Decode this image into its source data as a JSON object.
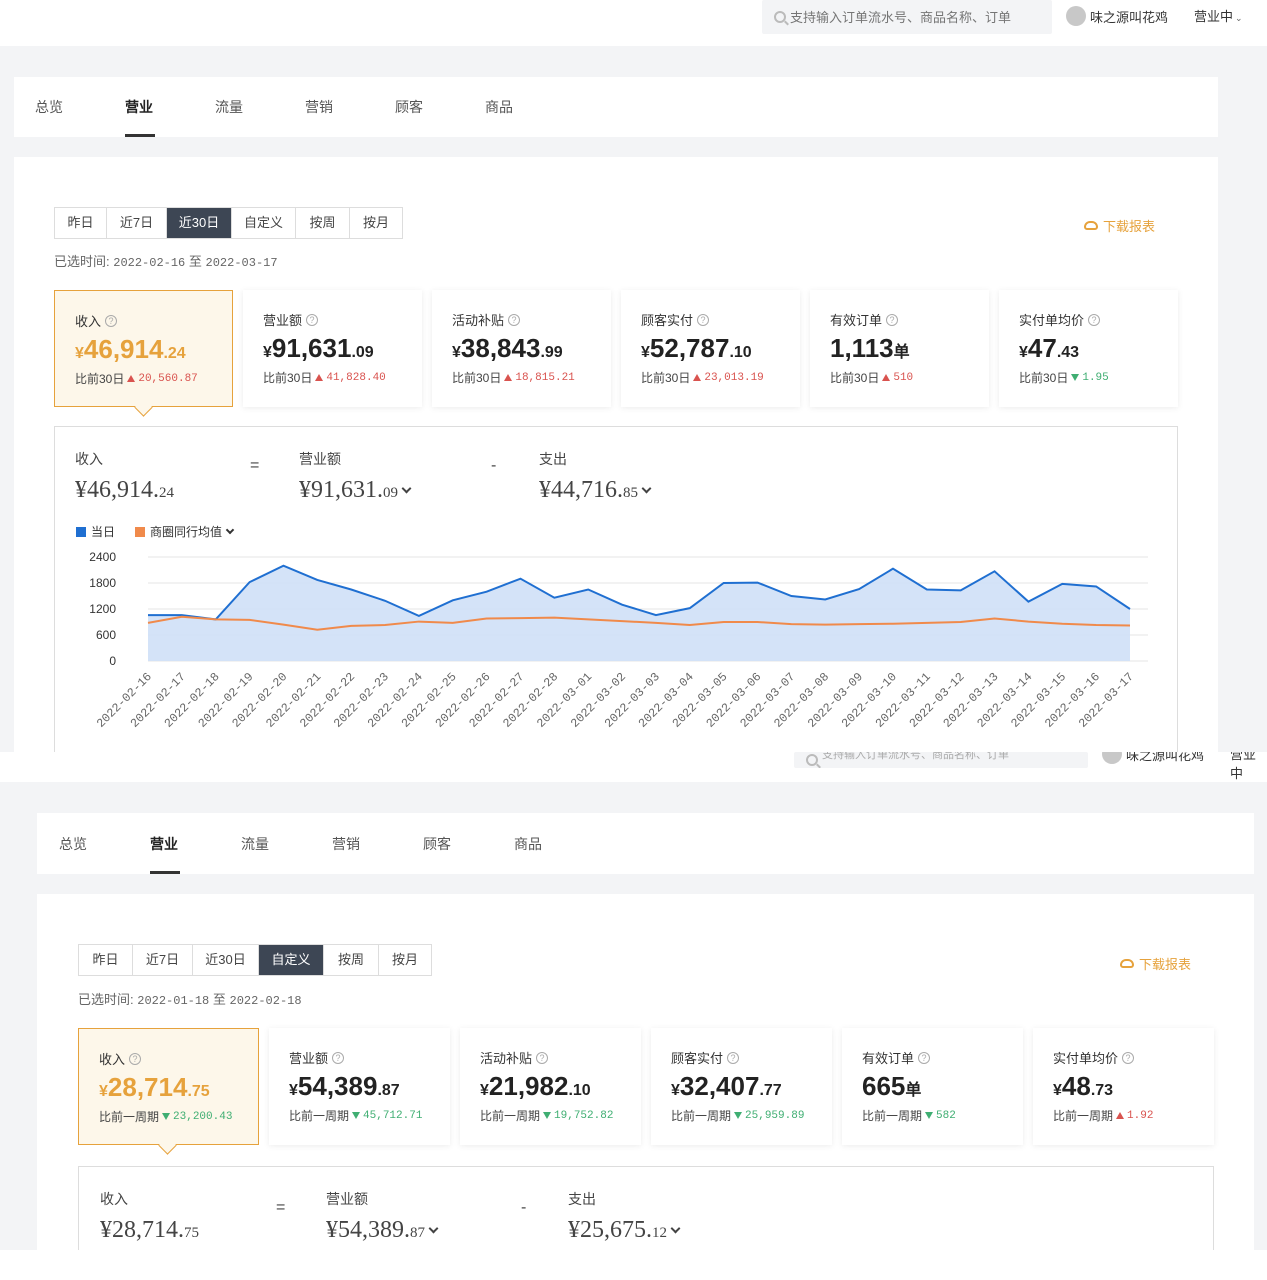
{
  "header": {
    "search_placeholder": "支持输入订单流水号、商品名称、订单",
    "user_name": "味之源叫花鸡",
    "status": "营业中"
  },
  "tabs": [
    "总览",
    "营业",
    "流量",
    "营销",
    "顾客",
    "商品"
  ],
  "active_tab": "营业",
  "periods": [
    "昨日",
    "近7日",
    "近30日",
    "自定义",
    "按周",
    "按月"
  ],
  "download_label": "下载报表",
  "screen1": {
    "active_period": "近30日",
    "range_label": "已选时间:",
    "range_start": "2022-02-16",
    "range_sep": "至",
    "range_end": "2022-03-17",
    "cards": [
      {
        "label": "收入",
        "cur": "¥",
        "int": "46,914",
        "dec": ".24",
        "cmp_label": "比前30日",
        "dir": "up",
        "delta": "20,560.87"
      },
      {
        "label": "营业额",
        "cur": "¥",
        "int": "91,631",
        "dec": ".09",
        "cmp_label": "比前30日",
        "dir": "up",
        "delta": "41,828.40"
      },
      {
        "label": "活动补贴",
        "cur": "¥",
        "int": "38,843",
        "dec": ".99",
        "cmp_label": "比前30日",
        "dir": "up",
        "delta": "18,815.21"
      },
      {
        "label": "顾客实付",
        "cur": "¥",
        "int": "52,787",
        "dec": ".10",
        "cmp_label": "比前30日",
        "dir": "up",
        "delta": "23,013.19"
      },
      {
        "label": "有效订单",
        "cur": "",
        "int": "1,113",
        "dec": "单",
        "cmp_label": "比前30日",
        "dir": "up",
        "delta": "510"
      },
      {
        "label": "实付单均价",
        "cur": "¥",
        "int": "47",
        "dec": ".43",
        "cmp_label": "比前30日",
        "dir": "down",
        "delta": "1.95"
      }
    ],
    "equation": {
      "a_label": "收入",
      "a_int": "¥46,914.",
      "a_dec": "24",
      "eq": "=",
      "b_label": "营业额",
      "b_int": "¥91,631.",
      "b_dec": "09",
      "minus": "-",
      "c_label": "支出",
      "c_int": "¥44,716.",
      "c_dec": "85"
    },
    "legend": {
      "current": "当日",
      "average": "商圈同行均值"
    }
  },
  "screen2": {
    "active_period": "自定义",
    "range_label": "已选时间:",
    "range_start": "2022-01-18",
    "range_sep": "至",
    "range_end": "2022-02-18",
    "cards": [
      {
        "label": "收入",
        "cur": "¥",
        "int": "28,714",
        "dec": ".75",
        "cmp_label": "比前一周期",
        "dir": "down",
        "delta": "23,200.43"
      },
      {
        "label": "营业额",
        "cur": "¥",
        "int": "54,389",
        "dec": ".87",
        "cmp_label": "比前一周期",
        "dir": "down",
        "delta": "45,712.71"
      },
      {
        "label": "活动补贴",
        "cur": "¥",
        "int": "21,982",
        "dec": ".10",
        "cmp_label": "比前一周期",
        "dir": "down",
        "delta": "19,752.82"
      },
      {
        "label": "顾客实付",
        "cur": "¥",
        "int": "32,407",
        "dec": ".77",
        "cmp_label": "比前一周期",
        "dir": "down",
        "delta": "25,959.89"
      },
      {
        "label": "有效订单",
        "cur": "",
        "int": "665",
        "dec": "单",
        "cmp_label": "比前一周期",
        "dir": "down",
        "delta": "582"
      },
      {
        "label": "实付单均价",
        "cur": "¥",
        "int": "48",
        "dec": ".73",
        "cmp_label": "比前一周期",
        "dir": "up",
        "delta": "1.92"
      }
    ],
    "equation": {
      "a_label": "收入",
      "a_int": "¥28,714.",
      "a_dec": "75",
      "eq": "=",
      "b_label": "营业额",
      "b_int": "¥54,389.",
      "b_dec": "87",
      "minus": "-",
      "c_label": "支出",
      "c_int": "¥25,675.",
      "c_dec": "12"
    }
  },
  "colors": {
    "accent": "#e6a23c",
    "series_current": "#1f6fd1",
    "series_average": "#f08a4b",
    "up": "#d9534f",
    "down": "#3fae72"
  },
  "chart_data": {
    "type": "area",
    "x": [
      "2022-02-16",
      "2022-02-17",
      "2022-02-18",
      "2022-02-19",
      "2022-02-20",
      "2022-02-21",
      "2022-02-22",
      "2022-02-23",
      "2022-02-24",
      "2022-02-25",
      "2022-02-26",
      "2022-02-27",
      "2022-02-28",
      "2022-03-01",
      "2022-03-02",
      "2022-03-03",
      "2022-03-04",
      "2022-03-05",
      "2022-03-06",
      "2022-03-07",
      "2022-03-08",
      "2022-03-09",
      "2022-03-10",
      "2022-03-11",
      "2022-03-12",
      "2022-03-13",
      "2022-03-14",
      "2022-03-15",
      "2022-03-16",
      "2022-03-17"
    ],
    "series": [
      {
        "name": "当日",
        "values": [
          1060,
          1060,
          960,
          1820,
          2200,
          1870,
          1650,
          1390,
          1040,
          1400,
          1600,
          1900,
          1460,
          1650,
          1300,
          1060,
          1220,
          1800,
          1810,
          1500,
          1420,
          1660,
          2130,
          1650,
          1630,
          2070,
          1370,
          1780,
          1720,
          1200
        ]
      },
      {
        "name": "商圈同行均值",
        "values": [
          880,
          1020,
          960,
          950,
          840,
          720,
          810,
          830,
          910,
          880,
          980,
          990,
          1000,
          960,
          920,
          880,
          830,
          900,
          900,
          850,
          840,
          850,
          860,
          880,
          900,
          980,
          910,
          860,
          830,
          820
        ]
      }
    ],
    "yticks": [
      0,
      600,
      1200,
      1800,
      2400
    ],
    "ylim": [
      0,
      2400
    ],
    "grid": true,
    "legend_position": "top-left"
  }
}
